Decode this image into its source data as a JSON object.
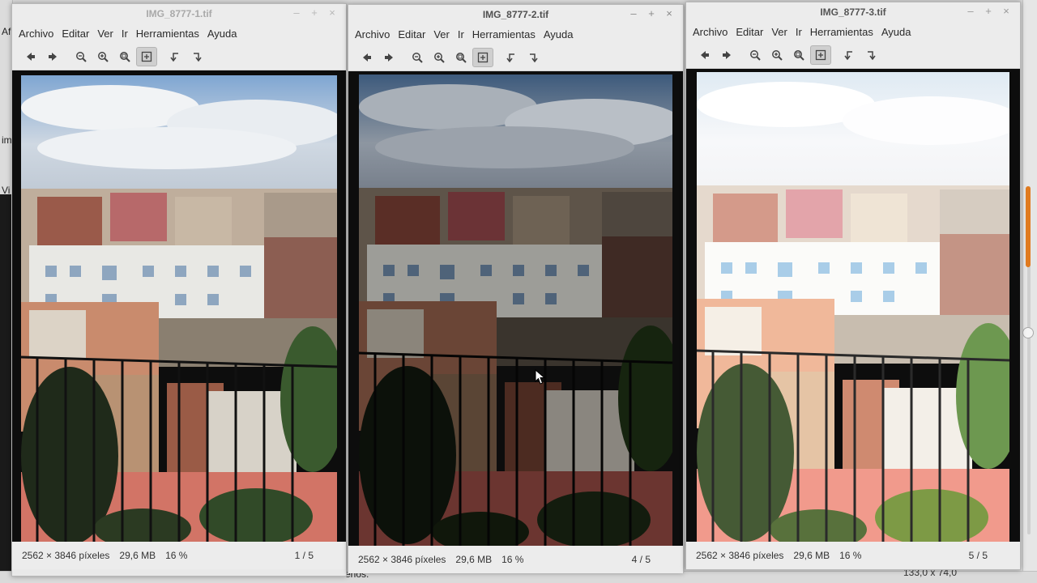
{
  "background": {
    "fragments": [
      "Af",
      "im",
      "Vi",
      "enos."
    ],
    "bottom_right_text": "133,0 x 74,0",
    "accent_color": "#e07a1f"
  },
  "windows": [
    {
      "title": "IMG_8777-1.tif",
      "menu": [
        "Archivo",
        "Editar",
        "Ver",
        "Ir",
        "Herramientas",
        "Ayuda"
      ],
      "status": {
        "dims": "2562 × 3846 píxeles",
        "size": "29,6 MB",
        "zoom": "16 %",
        "page": "1 / 5"
      },
      "variant": "normal"
    },
    {
      "title": "IMG_8777-2.tif",
      "menu": [
        "Archivo",
        "Editar",
        "Ver",
        "Ir",
        "Herramientas",
        "Ayuda"
      ],
      "status": {
        "dims": "2562 × 3846 píxeles",
        "size": "29,6 MB",
        "zoom": "16 %",
        "page": "4 / 5"
      },
      "variant": "dark"
    },
    {
      "title": "IMG_8777-3.tif",
      "menu": [
        "Archivo",
        "Editar",
        "Ver",
        "Ir",
        "Herramientas",
        "Ayuda"
      ],
      "status": {
        "dims": "2562 × 3846 píxeles",
        "size": "29,6 MB",
        "zoom": "16 %",
        "page": "5 / 5"
      },
      "variant": "bright"
    }
  ],
  "window_controls": [
    "–",
    "+",
    "×"
  ],
  "toolbar_icons": [
    "arrow-left-icon",
    "arrow-right-icon",
    "zoom-out-icon",
    "zoom-in-icon",
    "zoom-fit-icon",
    "best-fit-icon",
    "rotate-left-icon",
    "rotate-right-icon"
  ]
}
